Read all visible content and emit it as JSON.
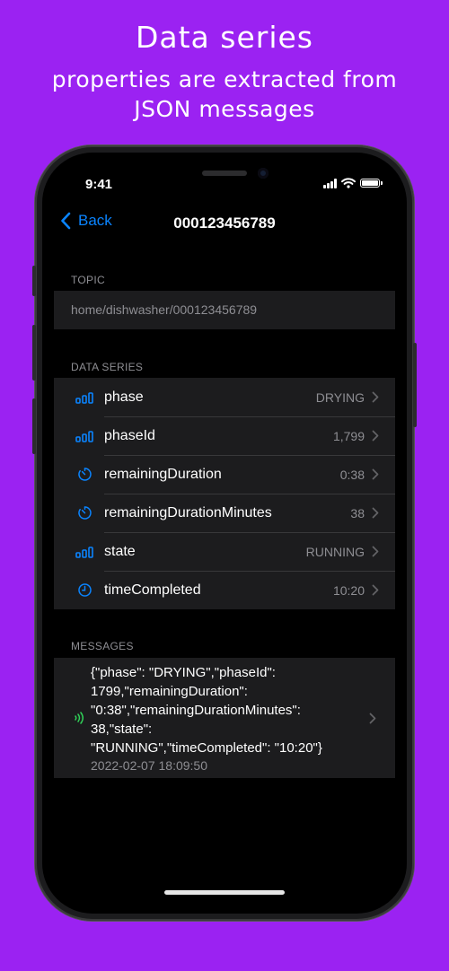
{
  "promo": {
    "title": "Data series",
    "subtitle_line1": "properties are extracted from",
    "subtitle_line2": "JSON messages"
  },
  "status_bar": {
    "time": "9:41"
  },
  "nav": {
    "back_label": "Back",
    "title": "000123456789"
  },
  "topic": {
    "header": "TOPIC",
    "value": "home/dishwasher/000123456789"
  },
  "data_series": {
    "header": "DATA SERIES",
    "items": [
      {
        "name": "phase",
        "value": "DRYING",
        "icon": "bar-chart-icon"
      },
      {
        "name": "phaseId",
        "value": "1,799",
        "icon": "bar-chart-icon"
      },
      {
        "name": "remainingDuration",
        "value": "0:38",
        "icon": "timer-icon"
      },
      {
        "name": "remainingDurationMinutes",
        "value": "38",
        "icon": "timer-icon"
      },
      {
        "name": "state",
        "value": "RUNNING",
        "icon": "bar-chart-icon"
      },
      {
        "name": "timeCompleted",
        "value": "10:20",
        "icon": "clock-icon"
      }
    ]
  },
  "messages": {
    "header": "MESSAGES",
    "items": [
      {
        "lines": [
          "{\"phase\": \"DRYING\",\"phaseId\":",
          "1799,\"remainingDuration\":",
          "\"0:38\",\"remainingDurationMinutes\":",
          "38,\"state\":",
          "\"RUNNING\",\"timeCompleted\": \"10:20\"}"
        ],
        "timestamp": "2022-02-07 18:09:50",
        "icon": "signal-waves-icon"
      }
    ]
  },
  "colors": {
    "background": "#9b22f2",
    "accent": "#0a84ff",
    "message_icon": "#30d158",
    "secondary_text": "#8e8e93",
    "card": "#1c1c1e"
  }
}
